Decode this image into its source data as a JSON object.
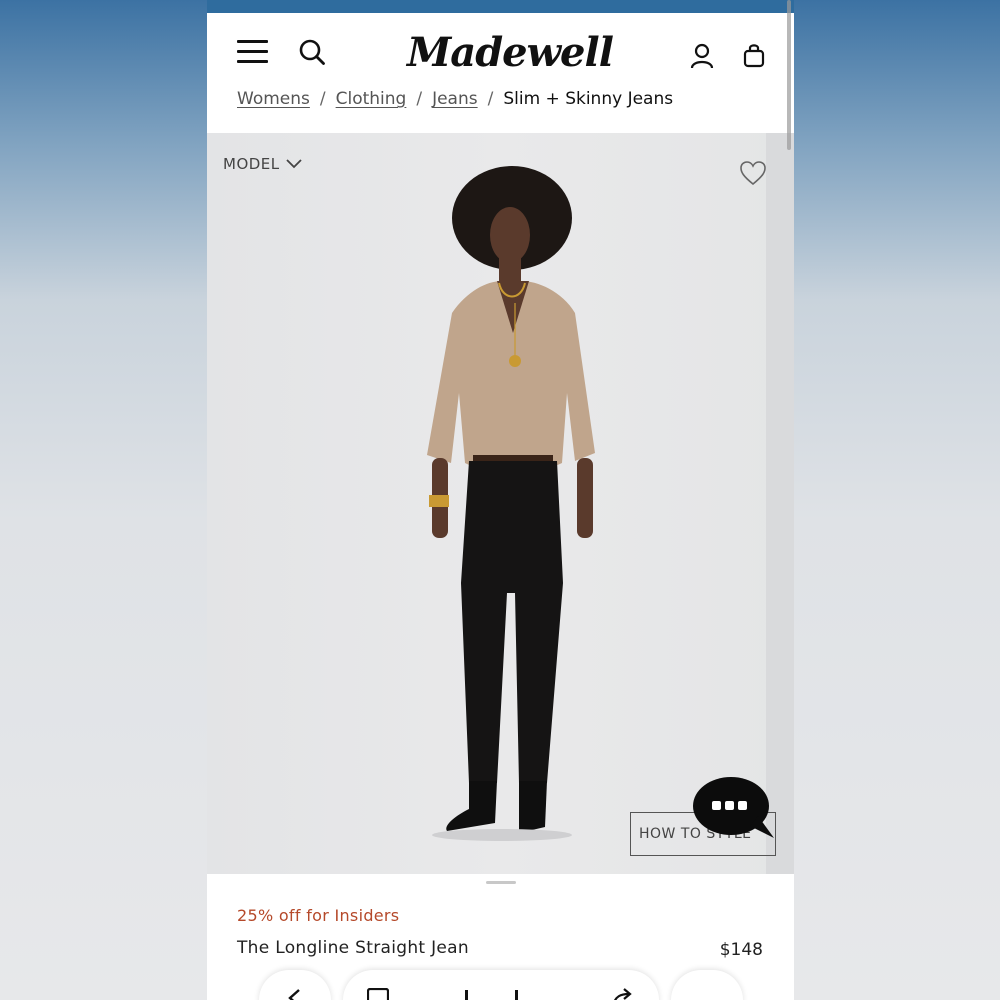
{
  "header": {
    "logo": "Madewell",
    "menu_icon": "hamburger-icon",
    "search_icon": "search-icon",
    "account_icon": "user-icon",
    "bag_icon": "shopping-bag-icon"
  },
  "breadcrumb": {
    "items": [
      "Womens",
      "Clothing",
      "Jeans"
    ],
    "separator": "/",
    "current": "Slim + Skinny Jeans"
  },
  "hero": {
    "model_toggle_label": "MODEL",
    "how_to_style_label": "HOW TO STYLE",
    "wishlist_icon": "heart-icon",
    "chat_icon": "chat-bubble-icon"
  },
  "product": {
    "promo": "25% off for Insiders",
    "name": "The Longline Straight Jean",
    "price": "$148"
  },
  "colors": {
    "topbar": "#2f6c9e",
    "promo": "#b5492a",
    "text": "#222222"
  }
}
